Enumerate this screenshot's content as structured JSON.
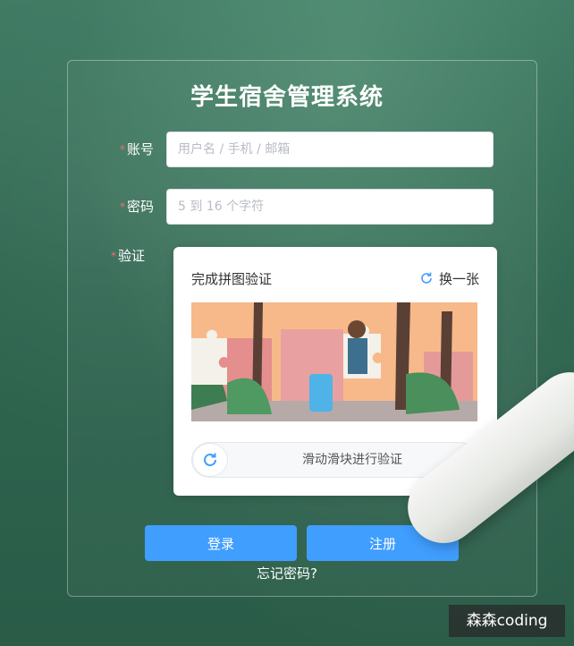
{
  "app_title": "学生宿舍管理系统",
  "form": {
    "required_mark": "*",
    "account_label": "账号",
    "account_placeholder": "用户名 / 手机 / 邮箱",
    "password_label": "密码",
    "password_placeholder": "5 到 16 个字符",
    "verify_label": "验证"
  },
  "captcha": {
    "title": "完成拼图验证",
    "refresh_label": "换一张",
    "slider_text": "滑动滑块进行验证",
    "icons": [
      "refresh-icon",
      "slider-refresh-icon"
    ]
  },
  "buttons": {
    "login_label": "登录",
    "register_label": "注册",
    "forgot_label": "忘记密码?"
  },
  "watermark": "森森coding",
  "colors": {
    "accent": "#409eff",
    "required": "#f56c6c",
    "background": "#2f6650"
  }
}
